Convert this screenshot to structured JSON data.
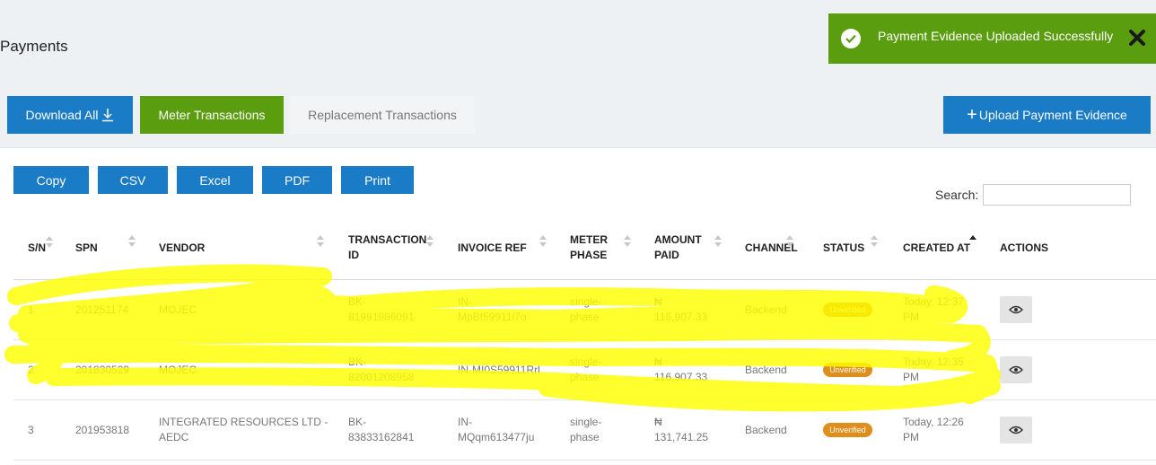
{
  "page": {
    "title": "Payments"
  },
  "toast": {
    "message": "Payment Evidence Uploaded Successfully",
    "icon": "check-circle-icon",
    "close_icon": "close-icon"
  },
  "toolbar": {
    "download_all": "Download All",
    "meter_transactions": "Meter Transactions",
    "replacement_transactions": "Replacement Transactions",
    "upload_payment_evidence": "Upload Payment Evidence",
    "upload_prefix": "+"
  },
  "export_buttons": [
    "Copy",
    "CSV",
    "Excel",
    "PDF",
    "Print"
  ],
  "search": {
    "label": "Search:",
    "value": ""
  },
  "table": {
    "columns": {
      "sn": "S/N",
      "spn": "SPN",
      "vendor": "VENDOR",
      "transaction_id_1": "TRANSACTION",
      "transaction_id_2": "ID",
      "invoice_ref": "INVOICE REF",
      "meter_phase_1": "METER",
      "meter_phase_2": "PHASE",
      "amount_paid_1": "AMOUNT",
      "amount_paid_2": "PAID",
      "channel": "CHANNEL",
      "status": "STATUS",
      "created_at": "CREATED AT",
      "actions": "ACTIONS"
    },
    "rows": [
      {
        "sn": "1",
        "spn": "201251174",
        "vendor_1": "MOJEC",
        "vendor_2": "",
        "txn_1": "BK-",
        "txn_2": "81991986091",
        "inv_1": "IN-",
        "inv_2": "MpBf59911i7o",
        "phase_1": "single-",
        "phase_2": "phase",
        "amount_1": "₦",
        "amount_2": "116,907.33",
        "channel": "Backend",
        "status": "Unverified",
        "created_1": "Today, 12:37",
        "created_2": "PM"
      },
      {
        "sn": "2",
        "spn": "201830529",
        "vendor_1": "MOJEC",
        "vendor_2": "",
        "txn_1": "BK-",
        "txn_2": "82001208958",
        "inv_1": "IN-MI0S59911Rrl",
        "inv_2": "",
        "phase_1": "single-",
        "phase_2": "phase",
        "amount_1": "₦",
        "amount_2": "116,907.33",
        "channel": "Backend",
        "status": "Unverified",
        "created_1": "Today, 12:35",
        "created_2": "PM"
      },
      {
        "sn": "3",
        "spn": "201953818",
        "vendor_1": "INTEGRATED RESOURCES LTD -",
        "vendor_2": "AEDC",
        "txn_1": "BK-",
        "txn_2": "83833162841",
        "inv_1": "IN-",
        "inv_2": "MQqm613477ju",
        "phase_1": "single-",
        "phase_2": "phase",
        "amount_1": "₦",
        "amount_2": "131,741.25",
        "channel": "Backend",
        "status": "Unverified",
        "created_1": "Today, 12:26",
        "created_2": "PM"
      }
    ]
  },
  "colors": {
    "primary": "#1a7cc7",
    "success": "#5a9e0f",
    "warning_badge": "#e08e1b",
    "highlight_scribble": "#ffff00"
  }
}
